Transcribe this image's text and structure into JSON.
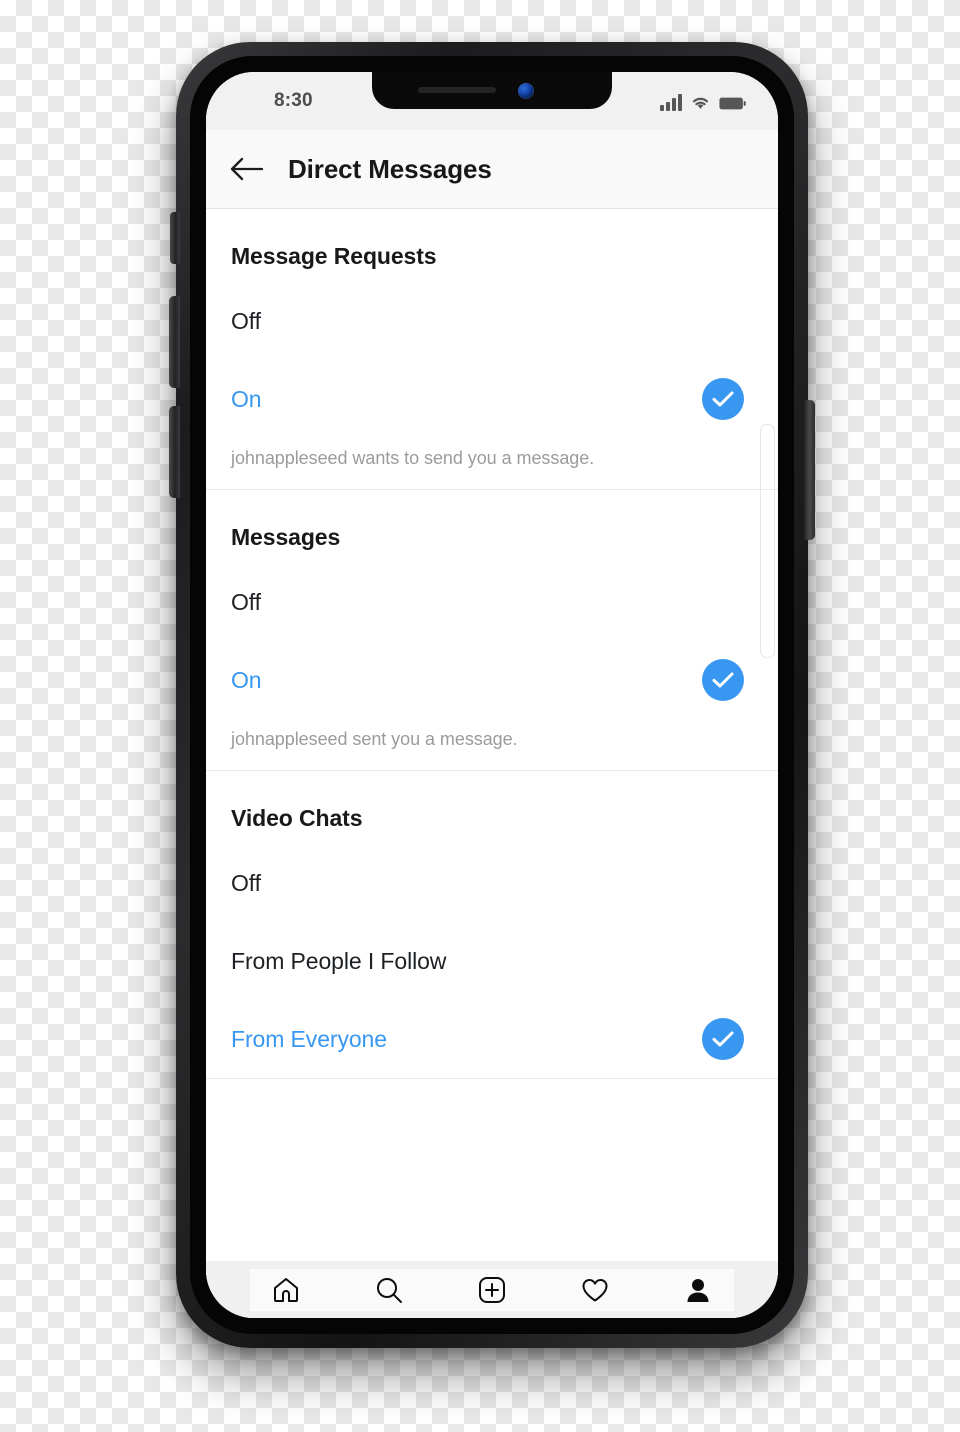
{
  "status_bar": {
    "time": "8:30",
    "icons": [
      "signal-bars-icon",
      "wifi-icon",
      "battery-icon"
    ]
  },
  "header": {
    "back_icon": "back-arrow-icon",
    "title": "Direct Messages"
  },
  "sections": [
    {
      "title": "Message Requests",
      "options": [
        {
          "label": "Off",
          "selected": false
        },
        {
          "label": "On",
          "selected": true
        }
      ],
      "hint": "johnappleseed wants to send you a message."
    },
    {
      "title": "Messages",
      "options": [
        {
          "label": "Off",
          "selected": false
        },
        {
          "label": "On",
          "selected": true
        }
      ],
      "hint": "johnappleseed sent you a message."
    },
    {
      "title": "Video Chats",
      "options": [
        {
          "label": "Off",
          "selected": false
        },
        {
          "label": "From People I Follow",
          "selected": false
        },
        {
          "label": "From Everyone",
          "selected": true
        }
      ],
      "hint": ""
    }
  ],
  "tabbar": {
    "items": [
      {
        "icon": "home-icon",
        "active": false
      },
      {
        "icon": "search-icon",
        "active": false
      },
      {
        "icon": "add-post-icon",
        "active": false
      },
      {
        "icon": "heart-icon",
        "active": false
      },
      {
        "icon": "profile-icon",
        "active": true
      }
    ]
  },
  "colors": {
    "accent": "#3897f0",
    "text_primary": "#1d2024",
    "text_hint": "#9b9b9b",
    "header_bg": "#f9f9f9",
    "status_bg": "#f1f1f1",
    "tabbar_bg": "#fafafa"
  }
}
